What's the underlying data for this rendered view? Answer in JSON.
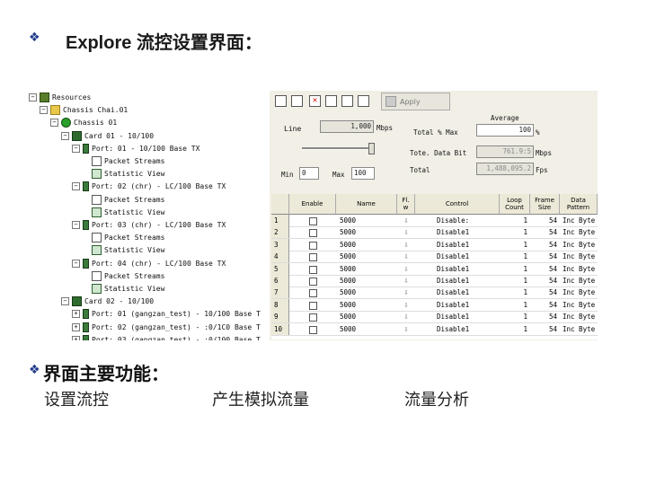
{
  "slide": {
    "heading": "Explore 流控设置界面：",
    "functions_heading": "界面主要功能：",
    "functions": [
      "设置流控",
      "产生模拟流量",
      "流量分析"
    ],
    "bullet_color": "#1f3a8a"
  },
  "tree": {
    "items": [
      {
        "label": "Resources",
        "icon": "resources-icon",
        "level": 0
      },
      {
        "label": "Chassis Chai.01",
        "icon": "folder-icon",
        "level": 1
      },
      {
        "label": "Chassis 01",
        "icon": "chassis-icon",
        "level": 2
      },
      {
        "label": "Card 01 - 10/100",
        "icon": "card-icon",
        "level": 3
      },
      {
        "label": "Port: 01  - 10/100 Base TX",
        "icon": "port-icon",
        "level": 4
      },
      {
        "label": "Packet Streams",
        "icon": "document-icon",
        "level": 5
      },
      {
        "label": "Statistic View",
        "icon": "statistic-icon",
        "level": 5
      },
      {
        "label": "Port: 02  (chr)  - LC/100 Base TX",
        "icon": "port-icon",
        "level": 4
      },
      {
        "label": "Packet Streams",
        "icon": "document-icon",
        "level": 5
      },
      {
        "label": "Statistic View",
        "icon": "statistic-icon",
        "level": 5
      },
      {
        "label": "Port: 03  (chr)  - LC/100 Base TX",
        "icon": "port-icon",
        "level": 4
      },
      {
        "label": "Packet Streams",
        "icon": "document-icon",
        "level": 5
      },
      {
        "label": "Statistic View",
        "icon": "statistic-icon",
        "level": 5
      },
      {
        "label": "Port: 04  (chr)  - LC/100 Base TX",
        "icon": "port-icon",
        "level": 4
      },
      {
        "label": "Packet Streams",
        "icon": "document-icon",
        "level": 5
      },
      {
        "label": "Statistic View",
        "icon": "statistic-icon",
        "level": 5
      },
      {
        "label": "Card 02 - 10/100",
        "icon": "card-icon",
        "level": 3
      },
      {
        "label": "Port: 01  (gangzan_test)  - 10/100 Base T",
        "icon": "port-icon",
        "level": 4
      },
      {
        "label": "Port: 02  (gangzan_test)  - :0/1C0 Base T",
        "icon": "port-icon",
        "level": 4
      },
      {
        "label": "Port: 03  (gangzan_test)  - :0/100 Base T",
        "icon": "port-icon",
        "level": 4
      }
    ]
  },
  "panel": {
    "apply_label": "Apply",
    "line_label": "Line",
    "line_value": "1,000",
    "line_unit": "Mbps",
    "average_label": "Average",
    "total_max_label": "Total % Max",
    "total_max_value": "100",
    "total_max_unit": "%",
    "total_data_bit_label": "Tote. Data Bit",
    "total_data_bit_value": "761.9:5",
    "total_data_bit_unit": "Mbps",
    "total_label": "Total",
    "total_value": "1,488,095.2",
    "total_unit": "Fps",
    "min_label": "Min",
    "min_value": "0",
    "max_label": "Max",
    "max_value": "100"
  },
  "table": {
    "headers": [
      "",
      "Enable",
      "Name",
      "Fl.\nw",
      "Control",
      "Loop\nCount",
      "Frame\nSize",
      "Data\nPattern"
    ],
    "rows": [
      {
        "num": "1",
        "name": "5000",
        "control": "Disable:",
        "loop": "1",
        "size": "54",
        "pattern": "Inc Byte"
      },
      {
        "num": "2",
        "name": "5000",
        "control": "Disable1",
        "loop": "1",
        "size": "54",
        "pattern": "Inc Byte"
      },
      {
        "num": "3",
        "name": "5000",
        "control": "Disable1",
        "loop": "1",
        "size": "54",
        "pattern": "Inc Byte"
      },
      {
        "num": "4",
        "name": "5000",
        "control": "Disable1",
        "loop": "1",
        "size": "54",
        "pattern": "Inc Byte"
      },
      {
        "num": "5",
        "name": "5000",
        "control": "Disable1",
        "loop": "1",
        "size": "54",
        "pattern": "Inc Byte"
      },
      {
        "num": "6",
        "name": "5000",
        "control": "Disable1",
        "loop": "1",
        "size": "54",
        "pattern": "Inc Byte"
      },
      {
        "num": "7",
        "name": "5000",
        "control": "Disable1",
        "loop": "1",
        "size": "54",
        "pattern": "Inc Byte"
      },
      {
        "num": "8",
        "name": "5000",
        "control": "Disable1",
        "loop": "1",
        "size": "54",
        "pattern": "Inc Byte"
      },
      {
        "num": "9",
        "name": "5000",
        "control": "Disable1",
        "loop": "1",
        "size": "54",
        "pattern": "Inc Byte"
      },
      {
        "num": "10",
        "name": "5000",
        "control": "Disable1",
        "loop": "1",
        "size": "54",
        "pattern": "Inc Byte"
      }
    ]
  }
}
